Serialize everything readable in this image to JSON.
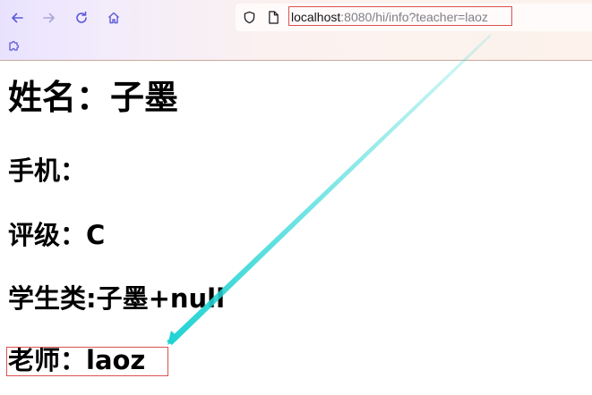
{
  "browser": {
    "url_host": "localhost",
    "url_rest": ":8080/hi/info?teacher=laoz",
    "accent": "#5b5bd6"
  },
  "page": {
    "name_heading": "姓名：子墨",
    "phone_heading": "手机：",
    "rating_heading": "评级：C",
    "student_heading": "学生类:子墨+null",
    "teacher_heading": "老师：laoz"
  },
  "annotation": {
    "highlight_color": "#d9534f",
    "arrow_color": "#22d3d3"
  }
}
